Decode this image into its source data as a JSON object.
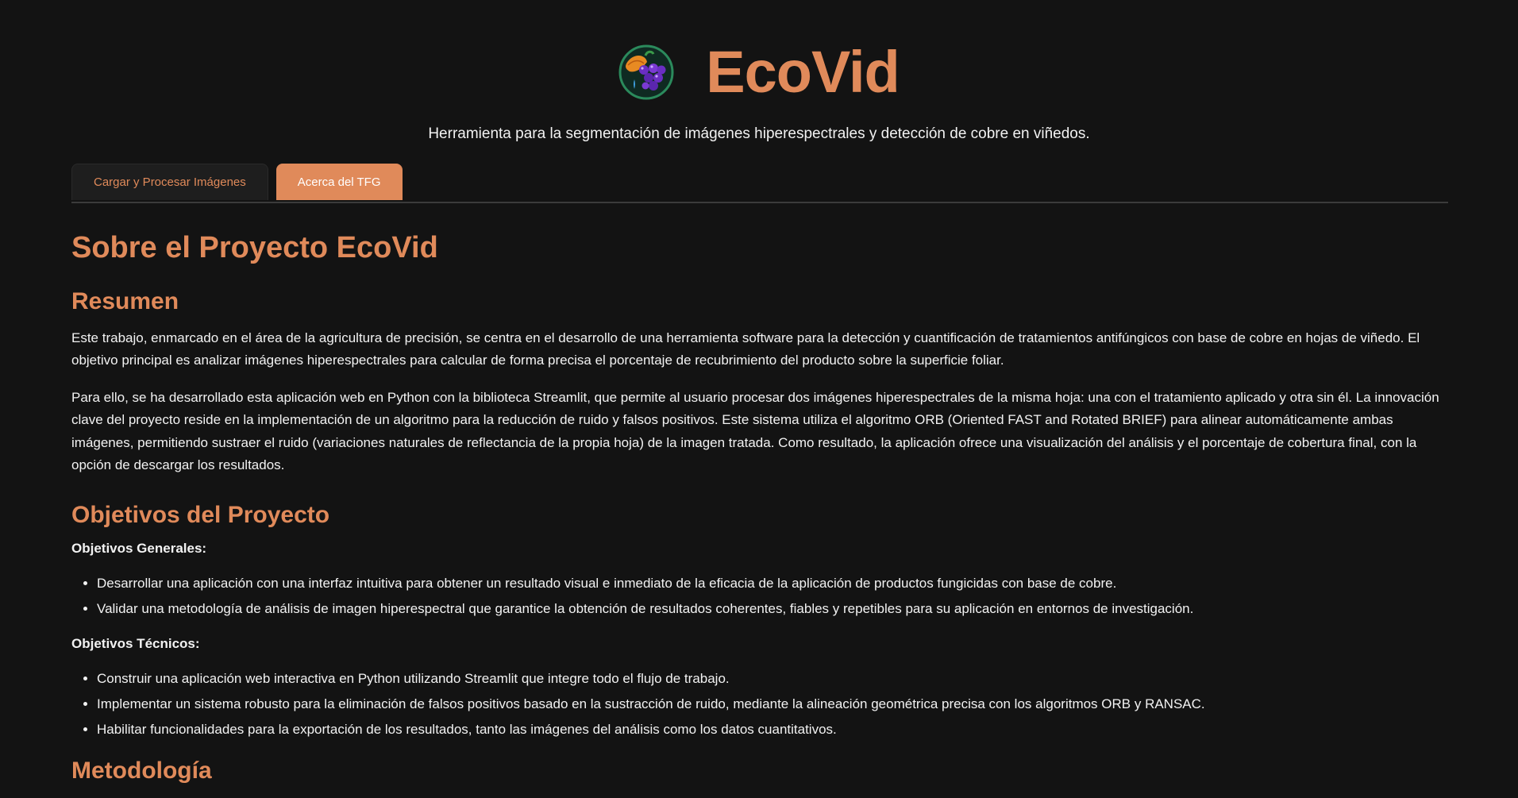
{
  "header": {
    "title": "EcoVid",
    "logo_icon": "grape-leaf-logo-icon",
    "subtitle": "Herramienta para la segmentación de imágenes hiperespectrales y detección de cobre en viñedos."
  },
  "tabs": [
    {
      "label": "Cargar y Procesar Imágenes",
      "active": false
    },
    {
      "label": "Acerca del TFG",
      "active": true
    }
  ],
  "content": {
    "page_title": "Sobre el Proyecto EcoVid",
    "resumen": {
      "heading": "Resumen",
      "paragraphs": [
        "Este trabajo, enmarcado en el área de la agricultura de precisión, se centra en el desarrollo de una herramienta software para la detección y cuantificación de tratamientos antifúngicos con base de cobre en hojas de viñedo. El objetivo principal es analizar imágenes hiperespectrales para calcular de forma precisa el porcentaje de recubrimiento del producto sobre la superficie foliar.",
        "Para ello, se ha desarrollado esta aplicación web en Python con la biblioteca Streamlit, que permite al usuario procesar dos imágenes hiperespectrales de la misma hoja: una con el tratamiento aplicado y otra sin él. La innovación clave del proyecto reside en la implementación de un algoritmo para la reducción de ruido y falsos positivos. Este sistema utiliza el algoritmo ORB (Oriented FAST and Rotated BRIEF) para alinear automáticamente ambas imágenes, permitiendo sustraer el ruido (variaciones naturales de reflectancia de la propia hoja) de la imagen tratada. Como resultado, la aplicación ofrece una visualización del análisis y el porcentaje de cobertura final, con la opción de descargar los resultados."
      ]
    },
    "objetivos": {
      "heading": "Objetivos del Proyecto",
      "generales_label": "Objetivos Generales:",
      "generales": [
        "Desarrollar una aplicación con una interfaz intuitiva para obtener un resultado visual e inmediato de la eficacia de la aplicación de productos fungicidas con base de cobre.",
        "Validar una metodología de análisis de imagen hiperespectral que garantice la obtención de resultados coherentes, fiables y repetibles para su aplicación en entornos de investigación."
      ],
      "tecnicos_label": "Objetivos Técnicos:",
      "tecnicos": [
        "Construir una aplicación web interactiva en Python utilizando Streamlit que integre todo el flujo de trabajo.",
        "Implementar un sistema robusto para la eliminación de falsos positivos basado en la sustracción de ruido, mediante la alineación geométrica precisa con los algoritmos ORB y RANSAC.",
        "Habilitar funcionalidades para la exportación de los resultados, tanto las imágenes del análisis como los datos cuantitativos."
      ]
    },
    "next_heading": "Metodología"
  },
  "colors": {
    "accent": "#e08a5a",
    "background": "#131313",
    "text": "#f2f2f2"
  }
}
